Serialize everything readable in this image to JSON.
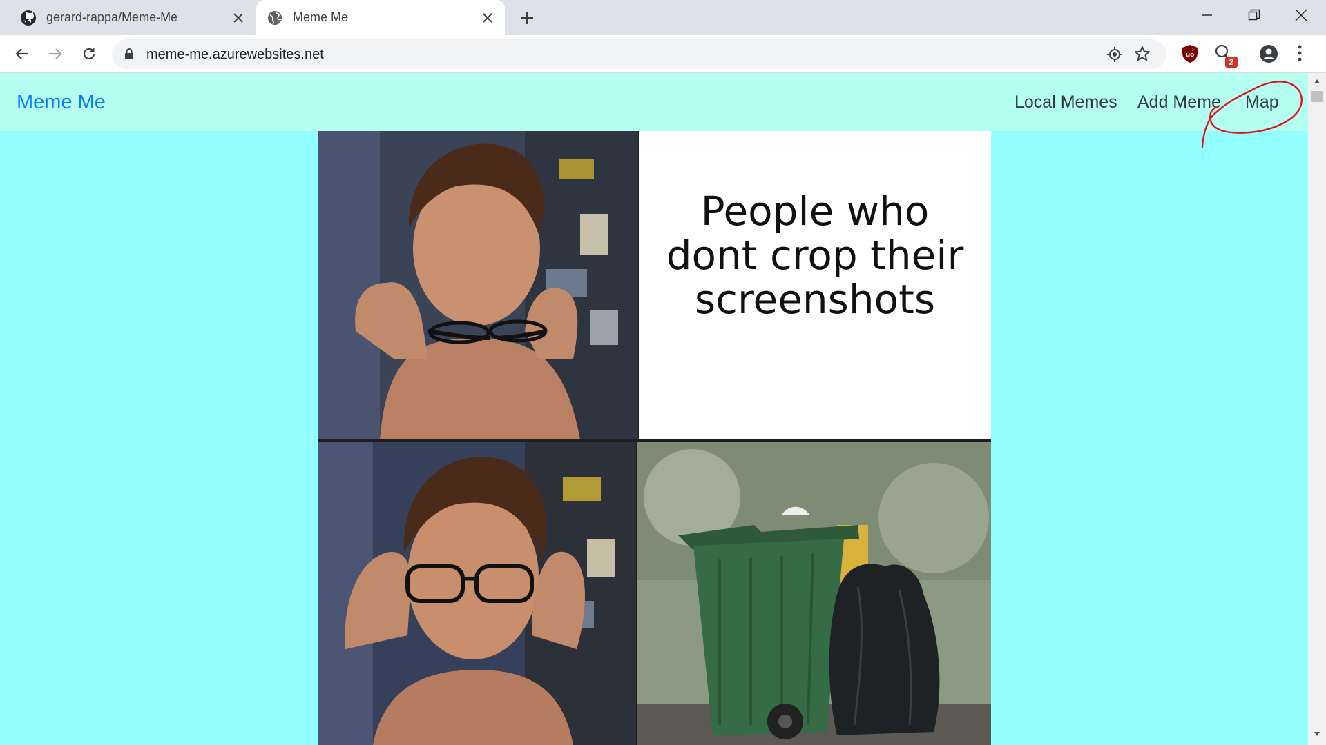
{
  "browser": {
    "tabs": [
      {
        "title": "gerard-rappa/Meme-Me",
        "icon": "github-icon",
        "active": false
      },
      {
        "title": "Meme Me",
        "icon": "globe-icon",
        "active": true
      }
    ],
    "url": "meme-me.azurewebsites.net",
    "extension_badge": "2"
  },
  "page": {
    "brand": "Meme Me",
    "nav": {
      "local_memes": "Local Memes",
      "add_meme": "Add Meme",
      "map": "Map"
    },
    "meme": {
      "caption": "People who dont crop their screenshots",
      "panels": [
        "person-removing-glasses",
        "caption-text",
        "person-putting-on-glasses",
        "trash-bin-and-bags"
      ]
    }
  },
  "colors": {
    "page_background": "#93ffff",
    "navbar_background": "#b4fff0",
    "brand_link": "#0d7dff",
    "annotation": "#e0141e"
  }
}
